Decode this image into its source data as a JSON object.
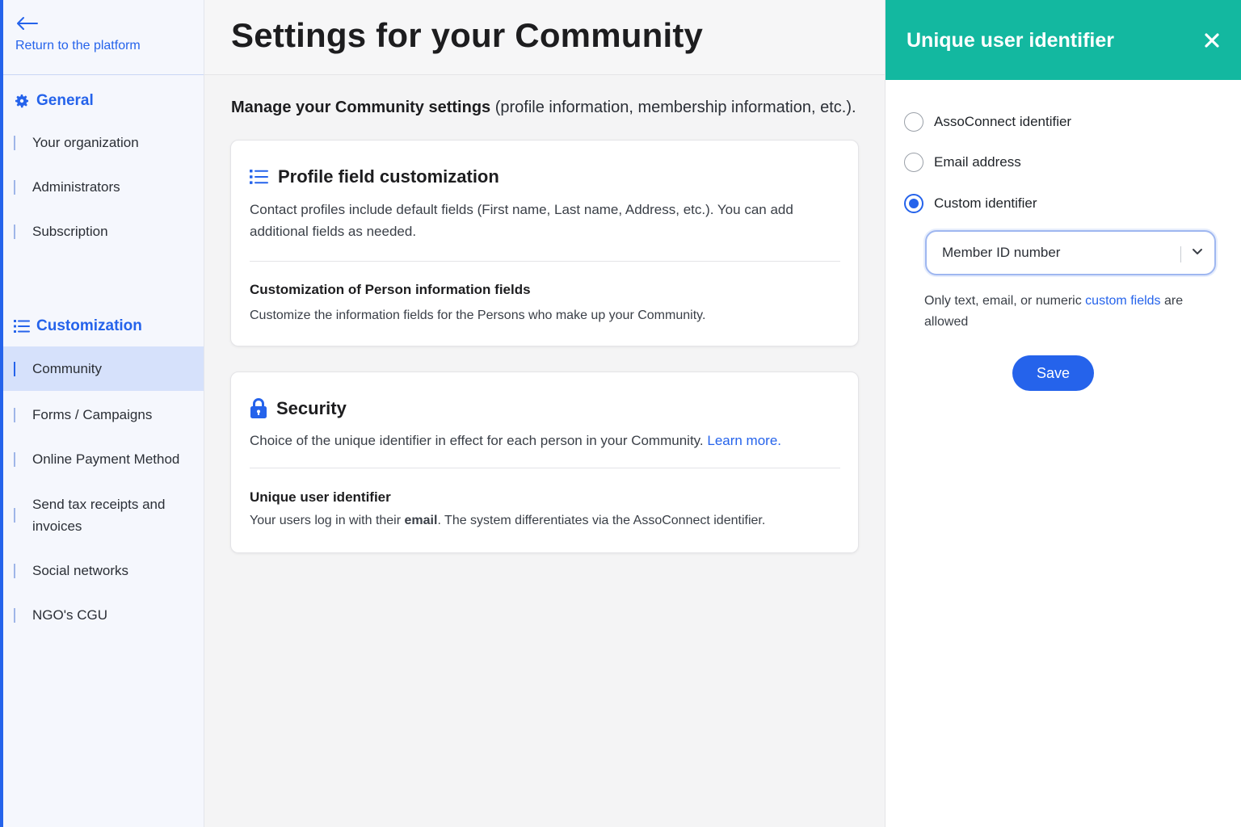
{
  "sidebar": {
    "back_label": "Return to the platform",
    "general": {
      "title": "General",
      "items": [
        "Your organization",
        "Administrators",
        "Subscription"
      ]
    },
    "customization": {
      "title": "Customization",
      "items": [
        "Community",
        "Forms / Campaigns",
        "Online Payment Method",
        "Send tax receipts and invoices",
        "Social networks",
        "NGO's CGU"
      ],
      "active": "Community"
    }
  },
  "main": {
    "title": "Settings for your Community",
    "subtitle_bold": "Manage your Community settings",
    "subtitle_rest": " (profile information, membership information, etc.).",
    "profile_card": {
      "title": "Profile field customization",
      "description": "Contact profiles include default fields (First name, Last name, Address, etc.). You can add additional fields as needed.",
      "sub_title": "Customization of Person information fields",
      "sub_desc": "Customize the information fields for the Persons who make up your Community."
    },
    "security_card": {
      "title": "Security",
      "description": "Choice of the unique identifier in effect for each person in your Community.",
      "learn_more": "Learn more.",
      "sub_title": "Unique user identifier",
      "sub_desc_pre": "Your users log in with their ",
      "sub_desc_bold": "email",
      "sub_desc_post": ". The system differentiates via the AssoConnect identifier."
    }
  },
  "panel": {
    "title": "Unique user identifier",
    "options": [
      "AssoConnect identifier",
      "Email address",
      "Custom identifier"
    ],
    "selected_option": "Custom identifier",
    "select_value": "Member ID number",
    "hint_pre": "Only text, email, or numeric ",
    "hint_link": "custom fields",
    "hint_post": " are allowed",
    "save_label": "Save"
  },
  "colors": {
    "accent": "#2563eb",
    "panel_header": "#13b8a0"
  }
}
